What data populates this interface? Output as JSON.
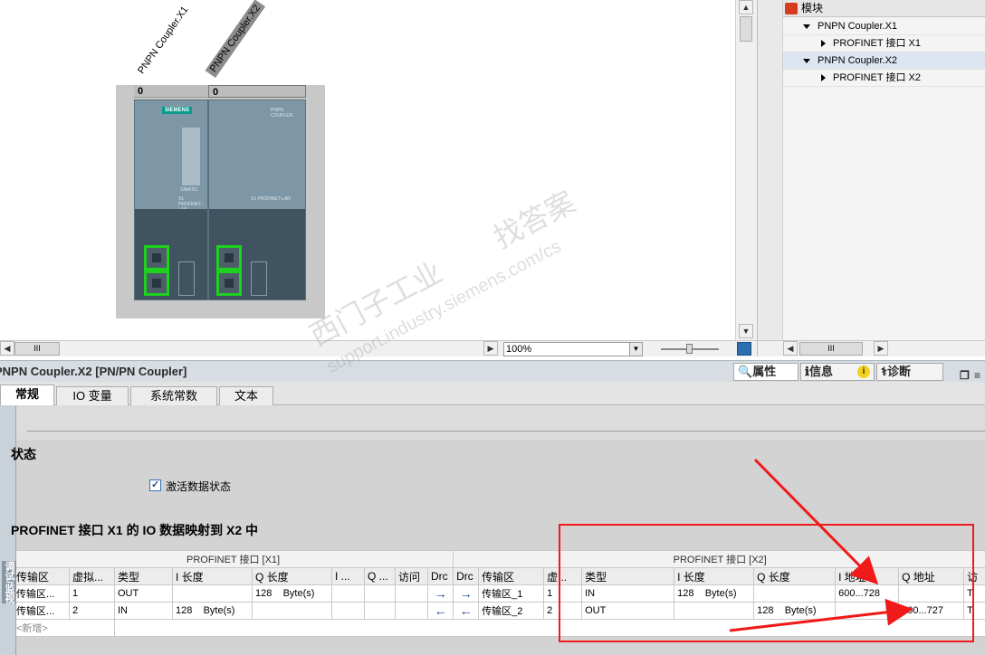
{
  "device_view": {
    "devices": [
      {
        "label": "PNPN Coupler.X1",
        "slot": "0",
        "selected": false
      },
      {
        "label": "PNPN Coupler.X2",
        "slot": "0",
        "selected": true
      }
    ],
    "module_texts": {
      "left_header": "SIEMENS",
      "left_brand": "SIMATIC",
      "right_header": "PNPN COUPLER",
      "port_text": "X1 PROFINET-LAN"
    },
    "zoom": "100%",
    "hscroll_grip": "III"
  },
  "overview": {
    "header": "模块",
    "rows": [
      {
        "label": "PNPN Coupler.X1",
        "level": 0,
        "expanded": true
      },
      {
        "label": "PROFINET 接口 X1",
        "level": 1,
        "expanded": false
      },
      {
        "label": "PNPN Coupler.X2",
        "level": 0,
        "expanded": true
      },
      {
        "label": "PROFINET 接口 X2",
        "level": 1,
        "expanded": false
      }
    ],
    "hscroll_grip": "III"
  },
  "properties": {
    "title": "PNPN Coupler.X2 [PN/PN Coupler]",
    "right_tabs": {
      "props": "属性",
      "info": "信息",
      "diag": "诊断"
    },
    "tabs": [
      "常规",
      "IO 变量",
      "系统常数",
      "文本"
    ],
    "side_label": "调试/监视",
    "section1_title": "状态",
    "checkbox_label": "激活数据状态",
    "checkbox_checked": true,
    "section2_title": "PROFINET 接口 X1 的 IO 数据映射到 X2 中",
    "table": {
      "group_x1": "PROFINET 接口 [X1]",
      "group_x2": "PROFINET 接口 [X2]",
      "headers": [
        "传输区",
        "虚拟...",
        "类型",
        "I 长度",
        "Q 长度",
        "I ...",
        "Q ...",
        "访问",
        "Drc",
        "Drc",
        "传输区",
        "虚...",
        "类型",
        "I 长度",
        "Q 长度",
        "I 地址",
        "Q 地址",
        "访"
      ],
      "rows": [
        {
          "x1_area": "传输区...",
          "x1_virt": "1",
          "x1_type": "OUT",
          "x1_ilen": "",
          "x1_iunit": "",
          "x1_qlen": "128",
          "x1_qunit": "Byte(s)",
          "drc1": "→",
          "drc2": "→",
          "x2_area": "传输区_1",
          "x2_virt": "1",
          "x2_type": "IN",
          "x2_ilen": "128",
          "x2_iunit": "Byte(s)",
          "x2_qlen": "",
          "x2_qunit": "",
          "x2_iaddr": "600...728",
          "x2_qaddr": "",
          "x2_access": "T"
        },
        {
          "x1_area": "传输区...",
          "x1_virt": "2",
          "x1_type": "IN",
          "x1_ilen": "128",
          "x1_iunit": "Byte(s)",
          "x1_qlen": "",
          "x1_qunit": "",
          "drc1": "←",
          "drc2": "←",
          "x2_area": "传输区_2",
          "x2_virt": "2",
          "x2_type": "OUT",
          "x2_ilen": "",
          "x2_iunit": "",
          "x2_qlen": "128",
          "x2_qunit": "Byte(s)",
          "x2_iaddr": "",
          "x2_qaddr": "600...727",
          "x2_access": "T"
        }
      ],
      "add_new": "<新增>"
    }
  },
  "watermark": {
    "line1": "西门子工业",
    "line2": "找答案",
    "line3": "support.industry.siemens.com/cs"
  },
  "colors": {
    "annotation_red": "#f01a1a",
    "port_green": "#1fd11f",
    "module_body": "#6f8796",
    "title_bar": "#d7dde3"
  }
}
